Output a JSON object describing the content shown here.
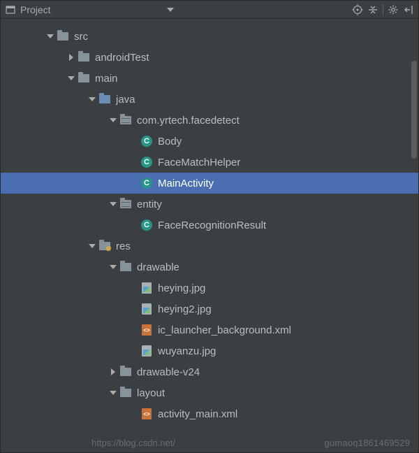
{
  "header": {
    "title": "Project"
  },
  "tree": {
    "src": "src",
    "androidTest": "androidTest",
    "main": "main",
    "java": "java",
    "pkg": "com.yrtech.facedetect",
    "body": "Body",
    "faceMatchHelper": "FaceMatchHelper",
    "mainActivity": "MainActivity",
    "entity": "entity",
    "faceRecognitionResult": "FaceRecognitionResult",
    "res": "res",
    "drawable": "drawable",
    "heying": "heying.jpg",
    "heying2": "heying2.jpg",
    "icLauncher": "ic_launcher_background.xml",
    "wuyanzu": "wuyanzu.jpg",
    "drawableV24": "drawable-v24",
    "layout": "layout",
    "activityMain": "activity_main.xml"
  },
  "watermark": {
    "right": "gumaoq1861469529",
    "left": "https://blog.csdn.net/"
  }
}
